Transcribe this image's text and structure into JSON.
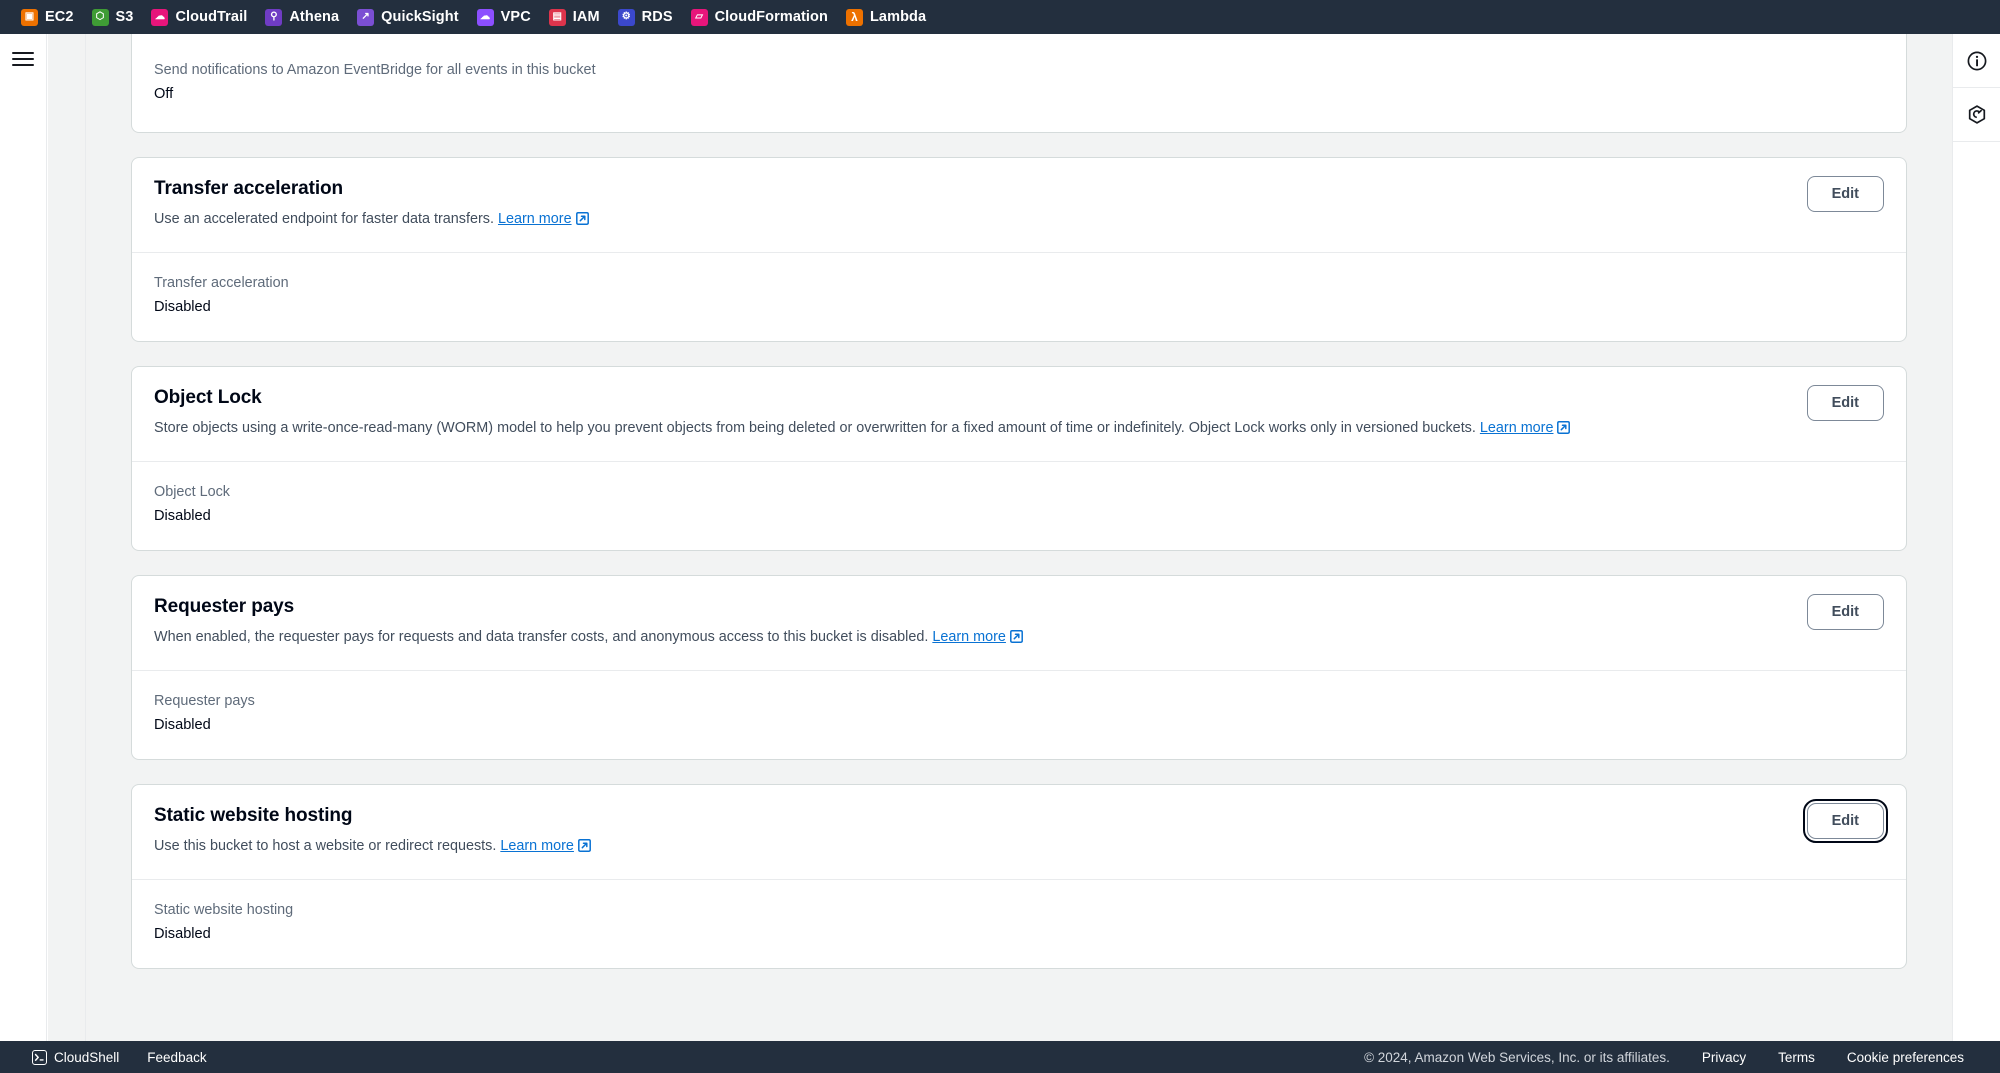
{
  "services_bar": {
    "items": [
      {
        "label": "EC2",
        "icon": "ec2-service-icon",
        "color": "#ed7100",
        "glyph": "◰"
      },
      {
        "label": "S3",
        "icon": "s3-service-icon",
        "color": "#3f9c35",
        "glyph": "⬡"
      },
      {
        "label": "CloudTrail",
        "icon": "cloudtrail-service-icon",
        "color": "#e7157b",
        "glyph": "☁"
      },
      {
        "label": "Athena",
        "icon": "athena-service-icon",
        "color": "#6f3cc4",
        "glyph": "🔍"
      },
      {
        "label": "QuickSight",
        "icon": "quicksight-service-icon",
        "color": "#7b4fd3",
        "glyph": "↗"
      },
      {
        "label": "VPC",
        "icon": "vpc-service-icon",
        "color": "#8c4fff",
        "glyph": "☁"
      },
      {
        "label": "IAM",
        "icon": "iam-service-icon",
        "color": "#dd344c",
        "glyph": "▤"
      },
      {
        "label": "RDS",
        "icon": "rds-service-icon",
        "color": "#3b48cc",
        "glyph": "⚙"
      },
      {
        "label": "CloudFormation",
        "icon": "cloudformation-service-icon",
        "color": "#e7157b",
        "glyph": "◱"
      },
      {
        "label": "Lambda",
        "icon": "lambda-service-icon",
        "color": "#ed7100",
        "glyph": "λ"
      }
    ]
  },
  "right_rail": {
    "info_icon": "info-circle-icon",
    "info_glyph": "i",
    "cloudshell_icon": "hexagon-tool-icon"
  },
  "sections": {
    "event_bridge": {
      "property_label": "Send notifications to Amazon EventBridge for all events in this bucket",
      "property_value": "Off"
    },
    "transfer_acceleration": {
      "title": "Transfer acceleration",
      "description": "Use an accelerated endpoint for faster data transfers.",
      "learn_more": "Learn more",
      "edit_label": "Edit",
      "property_label": "Transfer acceleration",
      "property_value": "Disabled"
    },
    "object_lock": {
      "title": "Object Lock",
      "description": "Store objects using a write-once-read-many (WORM) model to help you prevent objects from being deleted or overwritten for a fixed amount of time or indefinitely. Object Lock works only in versioned buckets.",
      "learn_more": "Learn more",
      "edit_label": "Edit",
      "property_label": "Object Lock",
      "property_value": "Disabled"
    },
    "requester_pays": {
      "title": "Requester pays",
      "description": "When enabled, the requester pays for requests and data transfer costs, and anonymous access to this bucket is disabled.",
      "learn_more": "Learn more",
      "edit_label": "Edit",
      "property_label": "Requester pays",
      "property_value": "Disabled"
    },
    "static_website_hosting": {
      "title": "Static website hosting",
      "description": "Use this bucket to host a website or redirect requests.",
      "learn_more": "Learn more",
      "edit_label": "Edit",
      "property_label": "Static website hosting",
      "property_value": "Disabled"
    }
  },
  "footer": {
    "cloudshell": "CloudShell",
    "feedback": "Feedback",
    "copyright": "© 2024, Amazon Web Services, Inc. or its affiliates.",
    "privacy": "Privacy",
    "terms": "Terms",
    "cookie_preferences": "Cookie preferences"
  },
  "colors": {
    "accent_link": "#0972d3",
    "nav_bg": "#232f3e",
    "page_bg": "#f2f3f3"
  }
}
